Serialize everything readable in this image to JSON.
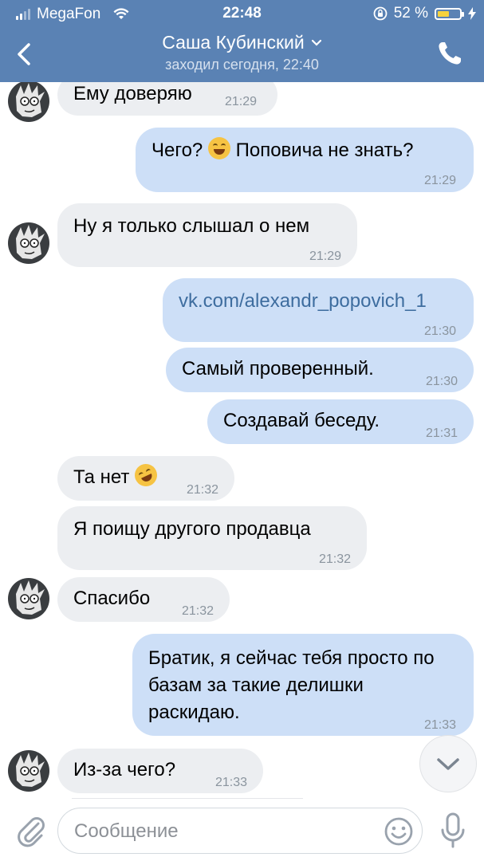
{
  "status_bar": {
    "carrier": "MegaFon",
    "time": "22:48",
    "battery": "52 %",
    "battery_level": 0.52
  },
  "header": {
    "contact_name": "Саша Кубинский",
    "last_seen": "заходил сегодня, 22:40"
  },
  "messages": [
    {
      "text": "Ему доверяю",
      "time": "21:29"
    },
    {
      "text_before": "Чего? ",
      "emoji": "face-with-tears-of-joy",
      "text_after": " Поповича не знать?",
      "time": "21:29"
    },
    {
      "text": "Ну я только слышал о нем",
      "time": "21:29"
    },
    {
      "text": "vk.com/alexandr_popovich_1",
      "time": "21:30"
    },
    {
      "text": "Самый проверенный.",
      "time": "21:30"
    },
    {
      "text": "Создавай беседу.",
      "time": "21:31"
    },
    {
      "text": "Та нет",
      "emoji": "rolling-on-floor-laughing",
      "time": "21:32"
    },
    {
      "text": "Я поищу другого продавца",
      "time": "21:32"
    },
    {
      "text": "Спасибо",
      "time": "21:32"
    },
    {
      "text": "Братик, я сейчас тебя просто по базам за такие делишки раскидаю.",
      "time": "21:33"
    },
    {
      "text": "Из-за чего?",
      "time": "21:33"
    }
  ],
  "composer": {
    "placeholder": "Сообщение"
  },
  "colors": {
    "header_bg": "#5a82b4",
    "incoming_bubble": "#eceef1",
    "outgoing_bubble": "#cddff7",
    "link": "#3e6d9f"
  }
}
